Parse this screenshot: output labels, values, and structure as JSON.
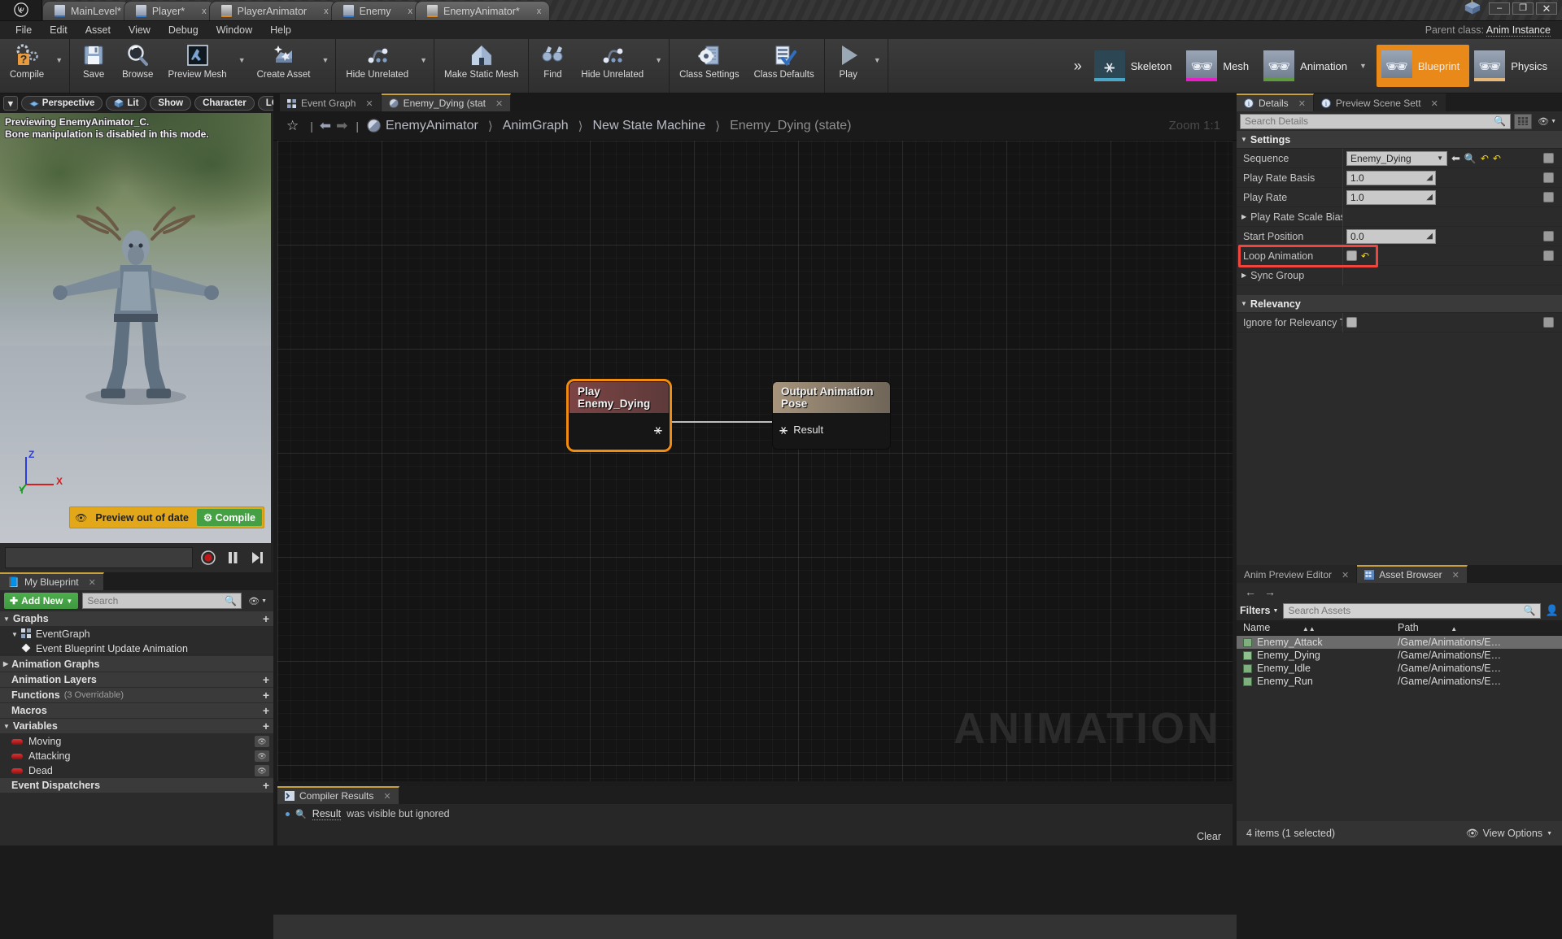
{
  "app": {
    "logo": "unreal-logo"
  },
  "titlebar": {
    "tabs": [
      {
        "label": "MainLevel*",
        "icon": "level-icon",
        "closable": false
      },
      {
        "label": "Player*",
        "icon": "blueprint-icon",
        "closable": true,
        "close": "x"
      },
      {
        "label": "PlayerAnimator",
        "icon": "anim-blueprint-icon",
        "closable": true,
        "close": "x"
      },
      {
        "label": "Enemy",
        "icon": "blueprint-icon",
        "closable": true,
        "close": "x"
      },
      {
        "label": "EnemyAnimator*",
        "icon": "anim-blueprint-icon",
        "closable": true,
        "close": "x"
      }
    ],
    "window_buttons": {
      "minimize": "–",
      "maximize": "❐",
      "close": "✕"
    }
  },
  "menubar": {
    "items": [
      "File",
      "Edit",
      "Asset",
      "View",
      "Debug",
      "Window",
      "Help"
    ],
    "parent_class_label": "Parent class:",
    "parent_class_value": "Anim Instance"
  },
  "toolbar": {
    "groups": [
      {
        "buttons": [
          {
            "label": "Compile",
            "icon": "compile-icon",
            "caret": true
          }
        ]
      },
      {
        "buttons": [
          {
            "label": "Save",
            "icon": "save-icon",
            "caret": false
          },
          {
            "label": "Browse",
            "icon": "browse-icon",
            "caret": false
          },
          {
            "label": "Preview Mesh",
            "icon": "preview-mesh-icon",
            "caret": true
          },
          {
            "label": "Create Asset",
            "icon": "create-asset-icon",
            "caret": true
          }
        ]
      },
      {
        "buttons": [
          {
            "label": "Hide Unrelated",
            "icon": "hide-unrelated-icon",
            "caret": true
          }
        ]
      },
      {
        "buttons": [
          {
            "label": "Make Static Mesh",
            "icon": "make-static-mesh-icon",
            "caret": false
          }
        ]
      },
      {
        "buttons": [
          {
            "label": "Find",
            "icon": "find-icon",
            "caret": false
          },
          {
            "label": "Hide Unrelated",
            "icon": "hide-unrelated-icon",
            "caret": true
          }
        ]
      },
      {
        "buttons": [
          {
            "label": "Class Settings",
            "icon": "class-settings-icon",
            "caret": false
          },
          {
            "label": "Class Defaults",
            "icon": "class-defaults-icon",
            "caret": false
          }
        ]
      },
      {
        "buttons": [
          {
            "label": "Play",
            "icon": "play-icon",
            "caret": true
          }
        ]
      }
    ],
    "modes": [
      {
        "label": "Skeleton",
        "active": false,
        "accent": "#4aa7c8"
      },
      {
        "label": "Mesh",
        "active": false,
        "accent": "#e81ec8"
      },
      {
        "label": "Animation",
        "active": false,
        "accent": "#5f9a3e",
        "caret": true
      },
      {
        "label": "Blueprint",
        "active": true,
        "accent": "#e8891a"
      },
      {
        "label": "Physics",
        "active": false,
        "accent": "#e8b878"
      }
    ],
    "expand_icon": "chevrons-right-icon"
  },
  "viewport": {
    "toolbar": {
      "caret": "▾",
      "buttons": [
        "Perspective",
        "Lit",
        "Show",
        "Character",
        "LOD"
      ]
    },
    "hint_line1": "Previewing EnemyAnimator_C.",
    "hint_line2": "Bone manipulation is disabled in this mode.",
    "preview_warning": "Preview out of date",
    "compile_button": "Compile",
    "axes": {
      "z": "Z",
      "x": "X",
      "y": "Y"
    },
    "transport": {
      "record": "record-icon",
      "pause": "pause-icon",
      "step": "step-forward-icon"
    }
  },
  "my_blueprint": {
    "tab_label": "My Blueprint",
    "tab_icon": "book-icon",
    "add_new": "Add New",
    "search_placeholder": "Search",
    "sections": [
      {
        "name": "Graphs",
        "expanded": true,
        "plus": true,
        "children": [
          {
            "label": "EventGraph",
            "icon": "event-graph-icon",
            "indent": 1,
            "expanded": true
          },
          {
            "label": "Event Blueprint Update Animation",
            "icon": "event-node-icon",
            "indent": 2
          }
        ]
      },
      {
        "name": "Animation Graphs",
        "expanded": false,
        "plus": false,
        "children": []
      },
      {
        "name": "Animation Layers",
        "expanded": false,
        "plus": true,
        "children": []
      },
      {
        "name": "Functions",
        "sub": "(3 Overridable)",
        "plus": true,
        "children": []
      },
      {
        "name": "Macros",
        "plus": true,
        "children": []
      },
      {
        "name": "Variables",
        "expanded": true,
        "plus": true,
        "children": [
          {
            "label": "Moving",
            "icon": "bool-variable-icon",
            "indent": 1,
            "eye": true
          },
          {
            "label": "Attacking",
            "icon": "bool-variable-icon",
            "indent": 1,
            "eye": true
          },
          {
            "label": "Dead",
            "icon": "bool-variable-icon",
            "indent": 1,
            "eye": true
          }
        ]
      },
      {
        "name": "Event Dispatchers",
        "plus": true,
        "children": []
      }
    ]
  },
  "graph": {
    "tabs": [
      {
        "label": "Event Graph",
        "icon": "event-graph-icon",
        "active": false,
        "close": "x"
      },
      {
        "label": "Enemy_Dying (stat",
        "icon": "state-icon",
        "active": true,
        "close": "x"
      }
    ],
    "breadcrumb": {
      "star_icon": "star-icon",
      "back_icon": "arrow-left-icon",
      "forward_icon": "arrow-right-icon",
      "root_icon": "state-machine-icon",
      "items": [
        "EnemyAnimator",
        "AnimGraph",
        "New State Machine",
        "Enemy_Dying (state)"
      ],
      "separator": "〉"
    },
    "zoom_label": "Zoom 1:1",
    "watermark": "ANIMATION",
    "nodes": [
      {
        "id": "play-node",
        "title": "Play Enemy_Dying",
        "selected": true,
        "pin_icon": "pose-pin-icon"
      },
      {
        "id": "output-node",
        "title": "Output Animation Pose",
        "selected": false,
        "pin_label": "Result",
        "pin_icon": "pose-pin-icon"
      }
    ]
  },
  "compiler": {
    "tab_label": "Compiler Results",
    "tab_icon": "compiler-icon",
    "messages": [
      {
        "link": "Result",
        "icon": "search-icon",
        "text": "was visible but ignored"
      }
    ],
    "clear_label": "Clear"
  },
  "details": {
    "tabs": [
      {
        "label": "Details",
        "icon": "details-icon",
        "active": true,
        "close": "x"
      },
      {
        "label": "Preview Scene Sett",
        "icon": "details-icon",
        "active": false,
        "close": "x"
      }
    ],
    "search_placeholder": "Search Details",
    "grid_icon": "grid-view-icon",
    "eye_icon": "eye-icon",
    "sections": [
      {
        "name": "Settings",
        "expanded": true,
        "rows": [
          {
            "label": "Sequence",
            "type": "combo",
            "value": "Enemy_Dying",
            "extras": [
              "arrow-left-icon",
              "search-icon",
              "reset-icon",
              "reset-icon"
            ],
            "tick": true
          },
          {
            "label": "Play Rate Basis",
            "type": "number",
            "value": "1.0",
            "tick": true
          },
          {
            "label": "Play Rate",
            "type": "number",
            "value": "1.0",
            "tick": true
          },
          {
            "label": "Play Rate Scale Bias",
            "type": "group",
            "expanded": false
          },
          {
            "label": "Start Position",
            "type": "number",
            "value": "0.0",
            "tick": true
          },
          {
            "label": "Loop Animation",
            "type": "checkbox",
            "checked": false,
            "extras": [
              "reset-icon"
            ],
            "tick": true,
            "highlighted": true
          },
          {
            "label": "Sync Group",
            "type": "group",
            "expanded": false
          }
        ]
      },
      {
        "name": "Relevancy",
        "expanded": true,
        "rows": [
          {
            "label": "Ignore for Relevancy T",
            "type": "checkbox",
            "checked": false,
            "tick": true
          }
        ]
      }
    ],
    "highlight_color": "#f0453f"
  },
  "asset_browser": {
    "tabs": [
      {
        "label": "Anim Preview Editor",
        "active": false,
        "close": "x"
      },
      {
        "label": "Asset Browser",
        "icon": "asset-browser-icon",
        "active": true,
        "close": "x"
      }
    ],
    "nav": {
      "back": "←",
      "forward": "→"
    },
    "filters_label": "Filters",
    "search_placeholder": "Search Assets",
    "columns": [
      "Name",
      "Path"
    ],
    "rows": [
      {
        "name": "Enemy_Attack",
        "path": "/Game/Animations/E…",
        "selected": true,
        "icon": "anim-sequence-icon"
      },
      {
        "name": "Enemy_Dying",
        "path": "/Game/Animations/E…",
        "selected": false,
        "icon": "anim-sequence-active-icon"
      },
      {
        "name": "Enemy_Idle",
        "path": "/Game/Animations/E…",
        "selected": false,
        "icon": "anim-sequence-icon"
      },
      {
        "name": "Enemy_Run",
        "path": "/Game/Animations/E…",
        "selected": false,
        "icon": "anim-sequence-icon"
      }
    ],
    "status": "4 items (1 selected)",
    "view_options": "View Options"
  }
}
